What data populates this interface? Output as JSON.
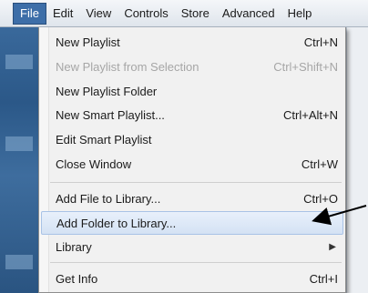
{
  "menubar": {
    "items": [
      "File",
      "Edit",
      "View",
      "Controls",
      "Store",
      "Advanced",
      "Help"
    ]
  },
  "file_menu": {
    "items": [
      {
        "label": "New Playlist",
        "shortcut": "Ctrl+N"
      },
      {
        "label": "New Playlist from Selection",
        "shortcut": "Ctrl+Shift+N",
        "disabled": true
      },
      {
        "label": "New Playlist Folder",
        "shortcut": ""
      },
      {
        "label": "New Smart Playlist...",
        "shortcut": "Ctrl+Alt+N"
      },
      {
        "label": "Edit Smart Playlist",
        "shortcut": ""
      },
      {
        "label": "Close Window",
        "shortcut": "Ctrl+W"
      },
      {
        "label": "Add File to Library...",
        "shortcut": "Ctrl+O"
      },
      {
        "label": "Add Folder to Library...",
        "shortcut": "",
        "highlighted": true
      },
      {
        "label": "Library",
        "shortcut": "",
        "submenu": true
      },
      {
        "label": "Get Info",
        "shortcut": "Ctrl+I"
      }
    ]
  },
  "colors": {
    "active_menu_bg": "#3d6ea8",
    "highlight_bg": "#d4e2f4",
    "disabled_text": "#a6a6a6"
  }
}
